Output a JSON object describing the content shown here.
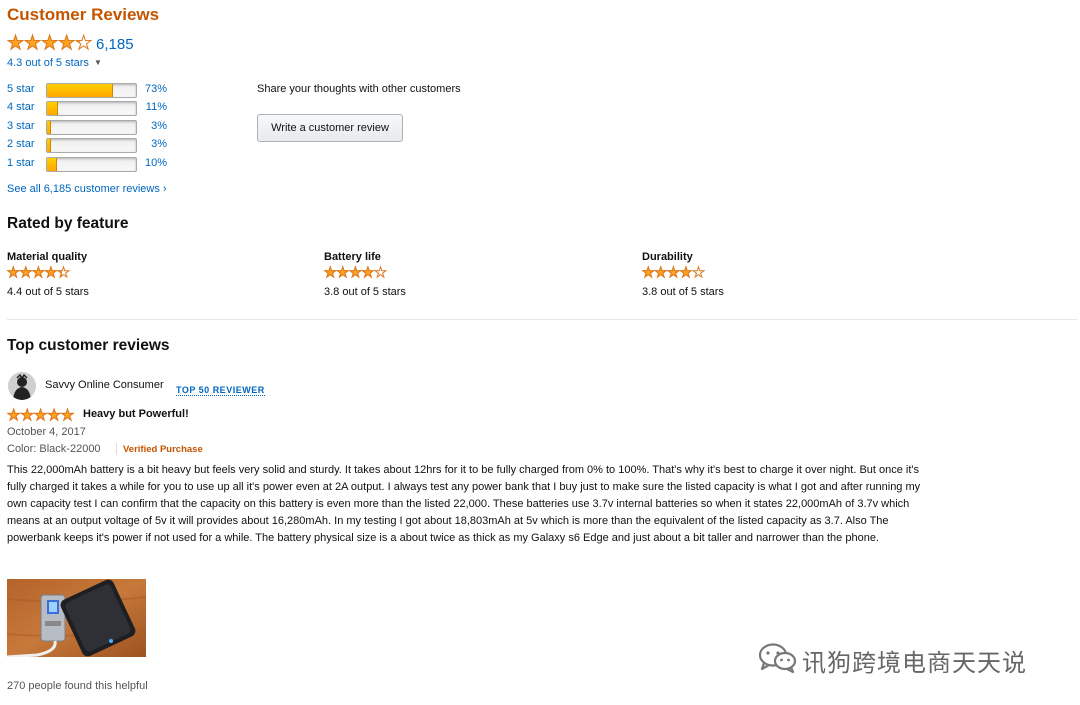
{
  "header": {
    "title": "Customer Reviews"
  },
  "overall": {
    "rating_value": 4.3,
    "count": "6,185",
    "rating_text": "4.3 out of 5 stars",
    "dropdown_icon": "caret-down-icon"
  },
  "histogram": [
    {
      "label": "5 star",
      "percent_text": "73%",
      "percent": 73
    },
    {
      "label": "4 star",
      "percent_text": "11%",
      "percent": 11
    },
    {
      "label": "3 star",
      "percent_text": "3%",
      "percent": 3
    },
    {
      "label": "2 star",
      "percent_text": "3%",
      "percent": 3
    },
    {
      "label": "1 star",
      "percent_text": "10%",
      "percent": 10
    }
  ],
  "see_all_link": "See all 6,185 customer reviews ›",
  "share": {
    "prompt": "Share your thoughts with other customers",
    "button_label": "Write a customer review"
  },
  "features": {
    "title": "Rated by feature",
    "items": [
      {
        "name": "Material quality",
        "rating_value": 4.4,
        "rating_text": "4.4 out of 5 stars"
      },
      {
        "name": "Battery life",
        "rating_value": 3.8,
        "rating_text": "3.8 out of 5 stars"
      },
      {
        "name": "Durability",
        "rating_value": 3.8,
        "rating_text": "3.8 out of 5 stars"
      }
    ]
  },
  "top_reviews": {
    "title": "Top customer reviews",
    "review": {
      "author": "Savvy Online Consumer",
      "badge": "TOP 50 REVIEWER",
      "rating_value": 5,
      "headline": "Heavy but Powerful!",
      "date": "October 4, 2017",
      "variant": "Color: Black-22000",
      "verified": "Verified Purchase",
      "body": "This 22,000mAh battery is a bit heavy but feels very solid and sturdy. It takes about 12hrs for it to be fully charged from 0% to 100%. That's why it's best to charge it over night. But once it's fully charged it takes a while for you to use up all it's power even at 2A output. I always test any power bank that I buy just to make sure the listed capacity is what I got and after running my own capacity test I can confirm that the capacity on this battery is even more than the listed 22,000. These batteries use 3.7v internal batteries so when it states 22,000mAh of 3.7v which means at an output voltage of 5v it will provides about 16,280mAh. In my testing I got about 18,803mAh at 5v which is more than the equivalent of the listed capacity as 3.7. Also The powerbank keeps it's power if not used for a while. The battery physical size is a about twice as thick as my Galaxy s6 Edge and just about a bit taller and narrower than the phone.",
      "helpful": "270 people found this helpful"
    }
  },
  "watermark": {
    "text": "讯狗跨境电商天天说",
    "icon": "wechat-icon"
  },
  "colors": {
    "accent_orange": "#c45500",
    "link_blue": "#0066c0",
    "star_gold": "#ffa41c"
  }
}
